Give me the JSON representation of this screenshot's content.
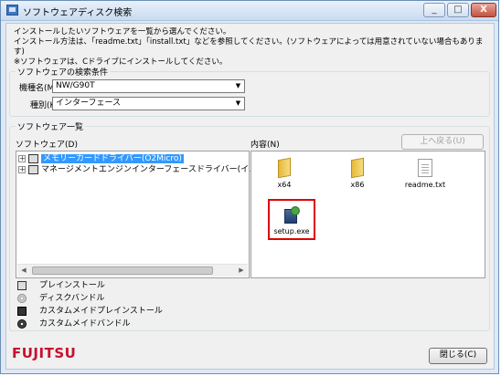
{
  "window": {
    "title": "ソフトウェアディスク検索",
    "minimize": "_",
    "maximize": "□",
    "close": "X"
  },
  "intro": {
    "line1": "インストールしたいソフトウェアを一覧から選んでください。",
    "line2": "インストール方法は、「readme.txt」「install.txt」などを参照してください。(ソフトウェアによっては用意されていない場合もあります)",
    "line3": "※ソフトウェアは、Cドライブにインストールしてください。"
  },
  "search": {
    "legend": "ソフトウェアの検索条件",
    "model_label": "機種名(M)",
    "model_value": "NW/G90T",
    "type_label": "種別(K)",
    "type_value": "インターフェース"
  },
  "list": {
    "legend": "ソフトウェア一覧",
    "software_label": "ソフトウェア(D)",
    "contents_label": "内容(N)",
    "up_button": "上へ戻る(U)",
    "tree": [
      {
        "label": "メモリーカードドライバー(O2Micro)",
        "selected": true
      },
      {
        "label": "マネージメントエンジンインターフェースドライバー(インテル(R",
        "selected": false
      }
    ],
    "files": [
      {
        "name": "x64",
        "kind": "folder"
      },
      {
        "name": "x86",
        "kind": "folder"
      },
      {
        "name": "readme.txt",
        "kind": "text"
      },
      {
        "name": "setup.exe",
        "kind": "setup"
      }
    ]
  },
  "legend_items": [
    {
      "label": "プレインストール",
      "icon": "preinstall-icon"
    },
    {
      "label": "ディスクバンドル",
      "icon": "disc-bundle-icon"
    },
    {
      "label": "カスタムメイドプレインストール",
      "icon": "custom-preinstall-icon"
    },
    {
      "label": "カスタムメイドバンドル",
      "icon": "custom-bundle-icon"
    }
  ],
  "brand": "FUJITSU",
  "close_button": "閉じる(C)",
  "colors": {
    "brand": "#c8102e",
    "selection": "#3399ff",
    "highlight": "#e00000"
  }
}
